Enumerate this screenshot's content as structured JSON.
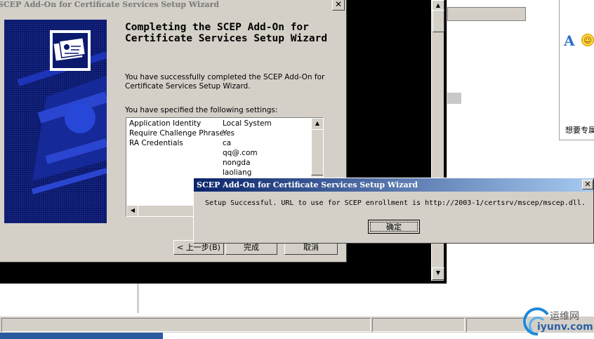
{
  "wizard": {
    "title": "SCEP Add-On for Certificate Services Setup Wizard",
    "heading": "Completing the SCEP Add-On for Certificate Services Setup Wizard",
    "description": "You have successfully completed the SCEP Add-On for Certificate Services Setup Wizard.",
    "settings_label": "You have specified the following settings:",
    "settings": [
      {
        "key": "Application Identity",
        "value": "Local System"
      },
      {
        "key": "Require Challenge Phrase",
        "value": "Yes"
      },
      {
        "key": "RA Credentials",
        "value": "ca"
      },
      {
        "key": "",
        "value": "qq@.com"
      },
      {
        "key": "",
        "value": "nongda"
      },
      {
        "key": "",
        "value": "laoliang"
      }
    ],
    "buttons": {
      "back": "< 上一步(B)",
      "finish": "完成",
      "cancel": "取消"
    }
  },
  "popup": {
    "title": "SCEP Add-On for Certificate Services Setup Wizard",
    "message": "Setup Successful.  URL to use for SCEP enrollment is http://2003-1/certsrv/mscep/mscep.dll.",
    "ok_label": "确定"
  },
  "im_window": {
    "font_glyph": "A",
    "text": "想要专属"
  },
  "watermark": {
    "name": "运维网",
    "url": "iyunv.com"
  },
  "colors": {
    "banner": "#0c1a6e",
    "titlebar_active": "#0a246a",
    "window_bg": "#d4d0c8"
  }
}
